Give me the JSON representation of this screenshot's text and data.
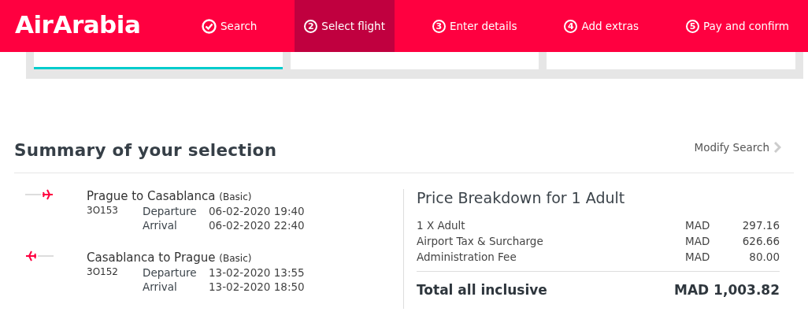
{
  "header": {
    "logo": "AirArabia",
    "steps": [
      {
        "label": "Search",
        "selected": false,
        "done": true
      },
      {
        "marker": "2",
        "label": "Select flight",
        "selected": true,
        "done": false
      },
      {
        "marker": "3",
        "label": "Enter details",
        "selected": false,
        "done": false
      },
      {
        "marker": "4",
        "label": "Add extras",
        "selected": false,
        "done": false
      },
      {
        "marker": "5",
        "label": "Pay and confirm",
        "selected": false,
        "done": false
      }
    ]
  },
  "fares": [
    {
      "selected": true
    },
    {
      "selected": false
    },
    {
      "selected": false
    }
  ],
  "summary": {
    "title": "Summary of your selection",
    "modify_link": "Modify Search",
    "flights": [
      {
        "kind": "outbound",
        "route": "Prague to Casablanca",
        "fare_class": "(Basic)",
        "flight_number": "3O153",
        "departure_label": "Departure",
        "departure": "06-02-2020 19:40",
        "arrival_label": "Arrival",
        "arrival": "06-02-2020 22:40"
      },
      {
        "kind": "return",
        "route": "Casablanca to Prague",
        "fare_class": "(Basic)",
        "flight_number": "3O152",
        "departure_label": "Departure",
        "departure": "13-02-2020 13:55",
        "arrival_label": "Arrival",
        "arrival": "13-02-2020 18:50"
      }
    ],
    "price": {
      "title": "Price Breakdown for 1 Adult",
      "rows": [
        {
          "label": "1 X Adult",
          "currency": "MAD",
          "amount": "297.16"
        },
        {
          "label": "Airport Tax & Surcharge",
          "currency": "MAD",
          "amount": "626.66"
        },
        {
          "label": "Administration Fee",
          "currency": "MAD",
          "amount": "80.00"
        }
      ],
      "total_label": "Total all inclusive",
      "total_currency": "MAD",
      "total_amount": "1,003.82"
    }
  }
}
